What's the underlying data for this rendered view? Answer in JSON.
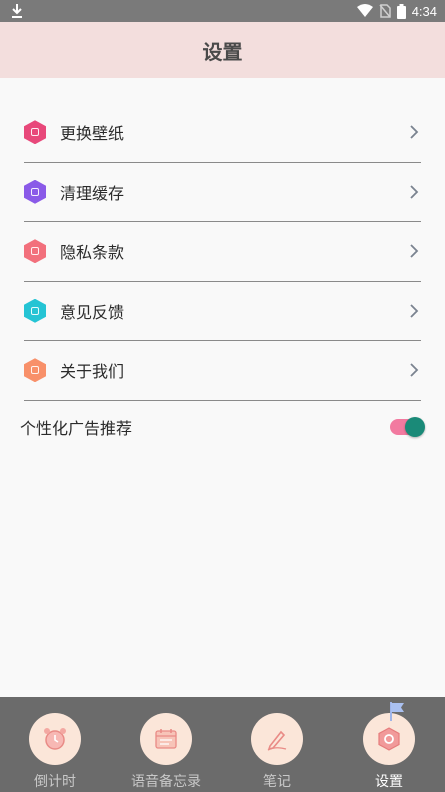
{
  "status_bar": {
    "time": "4:34",
    "icons": [
      "download-icon",
      "wifi-icon",
      "no-sim-icon",
      "battery-icon"
    ]
  },
  "header": {
    "title": "设置"
  },
  "settings": {
    "items": [
      {
        "label": "更换壁纸",
        "icon": "wallpaper-icon",
        "color": "#e8487a"
      },
      {
        "label": "清理缓存",
        "icon": "clean-cache-icon",
        "color": "#8a5ae8"
      },
      {
        "label": "隐私条款",
        "icon": "privacy-icon",
        "color": "#f2707c"
      },
      {
        "label": "意见反馈",
        "icon": "feedback-icon",
        "color": "#25c4d4"
      },
      {
        "label": "关于我们",
        "icon": "about-icon",
        "color": "#f8906a"
      }
    ],
    "ad_toggle": {
      "label": "个性化广告推荐",
      "on": true,
      "track_color": "#f27aa0",
      "knob_color": "#1a8a78"
    }
  },
  "tabbar": {
    "tabs": [
      {
        "label": "倒计时",
        "icon": "alarm-clock-icon",
        "active": false
      },
      {
        "label": "语音备忘录",
        "icon": "calendar-icon",
        "active": false
      },
      {
        "label": "笔记",
        "icon": "pen-icon",
        "active": false
      },
      {
        "label": "设置",
        "icon": "settings-hex-icon",
        "active": true
      }
    ]
  },
  "colors": {
    "header_bg": "#f3dedd",
    "statusbar_bg": "#7a7a7a",
    "tabbar_bg": "#6b6b6b",
    "tab_circle_bg": "#fbe6d9"
  }
}
